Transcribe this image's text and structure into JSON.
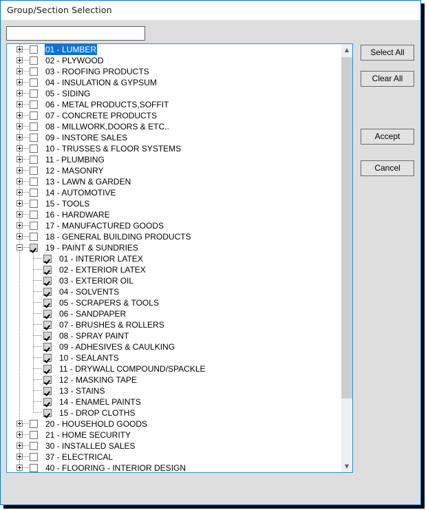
{
  "window": {
    "title": "Group/Section Selection",
    "accent_color": "#0078d7",
    "selection_color": "#0e72d4",
    "face_color": "#dedede"
  },
  "search": {
    "value": "",
    "placeholder": ""
  },
  "buttons": {
    "select_all": "Select All",
    "clear_all": "Clear All",
    "accept": "Accept",
    "cancel": "Cancel"
  },
  "scrollbar": {
    "up_arrow": "▲",
    "down_arrow": "▼"
  },
  "tree": {
    "rows": [
      {
        "label": "01 - LUMBER",
        "level": 0,
        "expander": "plus",
        "checked": false,
        "selected": true
      },
      {
        "label": "02 - PLYWOOD",
        "level": 0,
        "expander": "plus",
        "checked": false,
        "selected": false
      },
      {
        "label": "03 - ROOFING PRODUCTS",
        "level": 0,
        "expander": "plus",
        "checked": false,
        "selected": false
      },
      {
        "label": "04 - INSULATION & GYPSUM",
        "level": 0,
        "expander": "plus",
        "checked": false,
        "selected": false
      },
      {
        "label": "05 - SIDING",
        "level": 0,
        "expander": "plus",
        "checked": false,
        "selected": false
      },
      {
        "label": "06 - METAL PRODUCTS,SOFFIT",
        "level": 0,
        "expander": "plus",
        "checked": false,
        "selected": false
      },
      {
        "label": "07 - CONCRETE PRODUCTS",
        "level": 0,
        "expander": "plus",
        "checked": false,
        "selected": false
      },
      {
        "label": "08 - MILLWORK,DOORS & ETC..",
        "level": 0,
        "expander": "plus",
        "checked": false,
        "selected": false
      },
      {
        "label": "09 - INSTORE SALES",
        "level": 0,
        "expander": "plus",
        "checked": false,
        "selected": false
      },
      {
        "label": "10 - TRUSSES & FLOOR SYSTEMS",
        "level": 0,
        "expander": "plus",
        "checked": false,
        "selected": false
      },
      {
        "label": "11 - PLUMBING",
        "level": 0,
        "expander": "plus",
        "checked": false,
        "selected": false
      },
      {
        "label": "12 - MASONRY",
        "level": 0,
        "expander": "plus",
        "checked": false,
        "selected": false
      },
      {
        "label": "13 - LAWN & GARDEN",
        "level": 0,
        "expander": "plus",
        "checked": false,
        "selected": false
      },
      {
        "label": "14 - AUTOMOTIVE",
        "level": 0,
        "expander": "plus",
        "checked": false,
        "selected": false
      },
      {
        "label": "15 - TOOLS",
        "level": 0,
        "expander": "plus",
        "checked": false,
        "selected": false
      },
      {
        "label": "16 - HARDWARE",
        "level": 0,
        "expander": "plus",
        "checked": false,
        "selected": false
      },
      {
        "label": "17 - MANUFACTURED GOODS",
        "level": 0,
        "expander": "plus",
        "checked": false,
        "selected": false
      },
      {
        "label": "18 - GENERAL BUILDING PRODUCTS",
        "level": 0,
        "expander": "plus",
        "checked": false,
        "selected": false
      },
      {
        "label": "19 - PAINT & SUNDRIES",
        "level": 0,
        "expander": "minus",
        "checked": true,
        "selected": false
      },
      {
        "label": "01 - INTERIOR LATEX",
        "level": 1,
        "expander": "none",
        "checked": true,
        "selected": false
      },
      {
        "label": "02 - EXTERIOR LATEX",
        "level": 1,
        "expander": "none",
        "checked": true,
        "selected": false
      },
      {
        "label": "03 - EXTERIOR OIL",
        "level": 1,
        "expander": "none",
        "checked": true,
        "selected": false
      },
      {
        "label": "04 - SOLVENTS",
        "level": 1,
        "expander": "none",
        "checked": true,
        "selected": false
      },
      {
        "label": "05 - SCRAPERS & TOOLS",
        "level": 1,
        "expander": "none",
        "checked": true,
        "selected": false
      },
      {
        "label": "06 - SANDPAPER",
        "level": 1,
        "expander": "none",
        "checked": true,
        "selected": false
      },
      {
        "label": "07 - BRUSHES & ROLLERS",
        "level": 1,
        "expander": "none",
        "checked": true,
        "selected": false
      },
      {
        "label": "08 - SPRAY PAINT",
        "level": 1,
        "expander": "none",
        "checked": true,
        "selected": false
      },
      {
        "label": "09 - ADHESIVES & CAULKING",
        "level": 1,
        "expander": "none",
        "checked": true,
        "selected": false
      },
      {
        "label": "10 - SEALANTS",
        "level": 1,
        "expander": "none",
        "checked": true,
        "selected": false
      },
      {
        "label": "11 - DRYWALL COMPOUND/SPACKLE",
        "level": 1,
        "expander": "none",
        "checked": true,
        "selected": false
      },
      {
        "label": "12 - MASKING TAPE",
        "level": 1,
        "expander": "none",
        "checked": true,
        "selected": false
      },
      {
        "label": "13 - STAINS",
        "level": 1,
        "expander": "none",
        "checked": true,
        "selected": false
      },
      {
        "label": "14 - ENAMEL PAINTS",
        "level": 1,
        "expander": "none",
        "checked": true,
        "selected": false
      },
      {
        "label": "15 - DROP CLOTHS",
        "level": 1,
        "expander": "none",
        "checked": true,
        "selected": false
      },
      {
        "label": "20 - HOUSEHOLD GOODS",
        "level": 0,
        "expander": "plus",
        "checked": false,
        "selected": false
      },
      {
        "label": "21 - HOME SECURITY",
        "level": 0,
        "expander": "plus",
        "checked": false,
        "selected": false
      },
      {
        "label": "30 - INSTALLED SALES",
        "level": 0,
        "expander": "plus",
        "checked": false,
        "selected": false
      },
      {
        "label": "37 - ELECTRICAL",
        "level": 0,
        "expander": "plus",
        "checked": false,
        "selected": false
      },
      {
        "label": "40 - FLOORING - INTERIOR DESIGN",
        "level": 0,
        "expander": "plus",
        "checked": false,
        "selected": false
      }
    ]
  }
}
